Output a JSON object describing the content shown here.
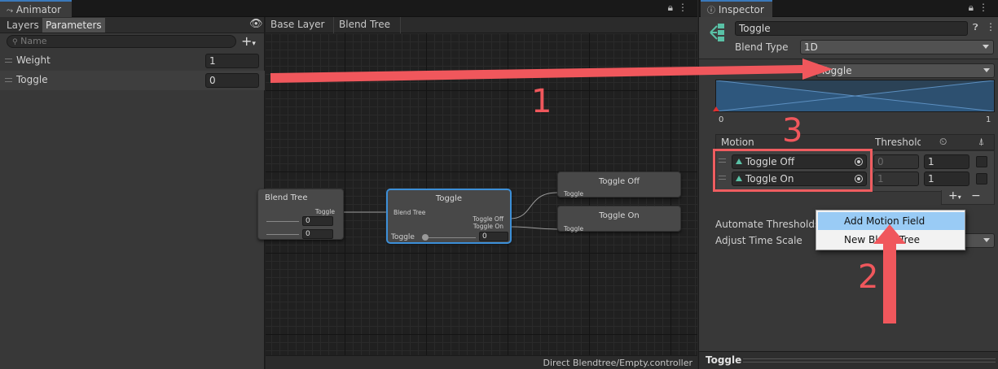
{
  "animator": {
    "tab_title": "Animator",
    "subtabs": [
      "Layers",
      "Parameters"
    ],
    "search_placeholder": "Name",
    "parameters": [
      {
        "name": "Weight",
        "value": "1"
      },
      {
        "name": "Toggle",
        "value": "0"
      }
    ],
    "breadcrumbs": [
      "Base Layer",
      "Blend Tree"
    ],
    "status_path": "Direct Blendtree/Empty.controller",
    "nodes": {
      "parent": {
        "title": "Blend Tree",
        "param": "Toggle",
        "field1": "0",
        "field2": "0"
      },
      "toggle": {
        "title": "Toggle",
        "input": "Blend Tree",
        "out1": "Toggle Off",
        "out2": "Toggle On",
        "param": "Toggle",
        "value": "0"
      },
      "off": {
        "title": "Toggle Off",
        "port": "Toggle"
      },
      "on": {
        "title": "Toggle On",
        "port": "Toggle"
      }
    }
  },
  "inspector": {
    "tab_title": "Inspector",
    "name_value": "Toggle",
    "blend_type_label": "Blend Type",
    "blend_type_value": "1D",
    "parameter_value": "Toggle",
    "axis_min": "0",
    "axis_max": "1",
    "col_motion": "Motion",
    "col_threshold": "Threshold",
    "motions": [
      {
        "name": "Toggle Off",
        "threshold": "0",
        "speed": "1"
      },
      {
        "name": "Toggle On",
        "threshold": "1",
        "speed": "1"
      }
    ],
    "automate_label": "Automate Thresholds",
    "adjust_label": "Adjust Time Scale",
    "popup": {
      "item1": "Add Motion Field",
      "item2": "New Blend Tree"
    },
    "footer_title": "Toggle"
  },
  "annotations": {
    "n1": "1",
    "n2": "2",
    "n3": "3"
  },
  "colors": {
    "accent": "#3a79bb",
    "annotation": "#ef5d60",
    "highlight": "#99cbf5"
  }
}
